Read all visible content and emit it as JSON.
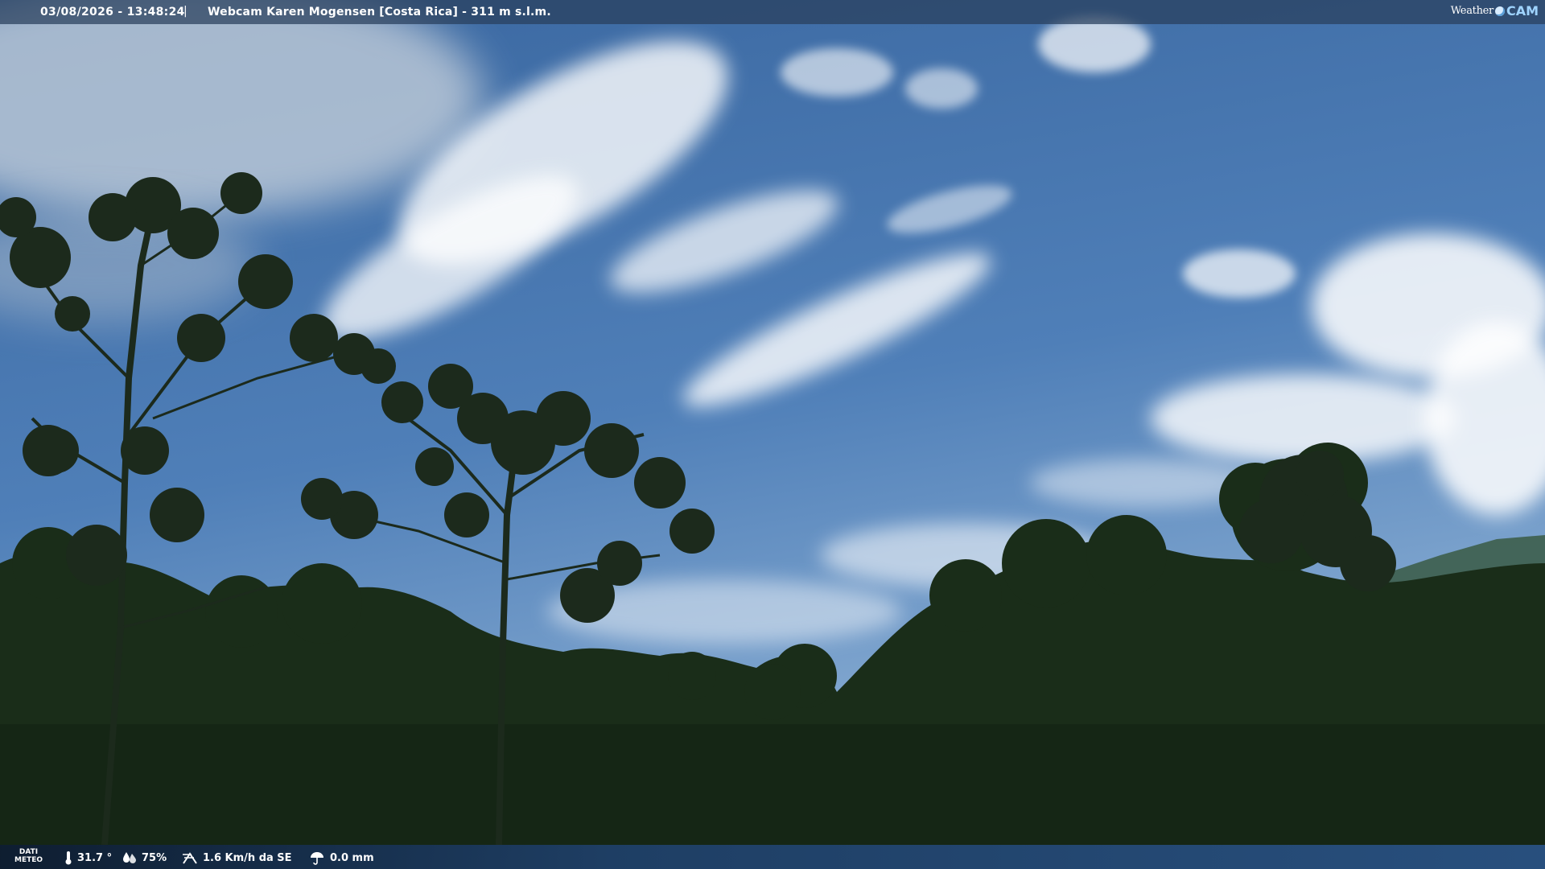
{
  "overlay": {
    "datetime": "03/08/2026 - 13:48:24",
    "separator": "|",
    "title": "Webcam Karen Mogensen [Costa Rica] - 311 m s.l.m.",
    "brand_weather": "Weather",
    "brand_cam": "CAM"
  },
  "meteo": {
    "label_line1": "DATI",
    "label_line2": "METEO",
    "temperature": "31.7 °",
    "temperature_icon": "thermometer-icon",
    "humidity": "75%",
    "humidity_icon": "humidity-drop-icon",
    "wind": "1.6 Km/h da SE",
    "wind_icon": "wind-icon",
    "rain": "0.0 mm",
    "rain_icon": "umbrella-icon"
  },
  "colors": {
    "sky_top": "#2f5f9a",
    "sky_bottom": "#7ea6cf",
    "foliage": "#1b2e1a"
  }
}
